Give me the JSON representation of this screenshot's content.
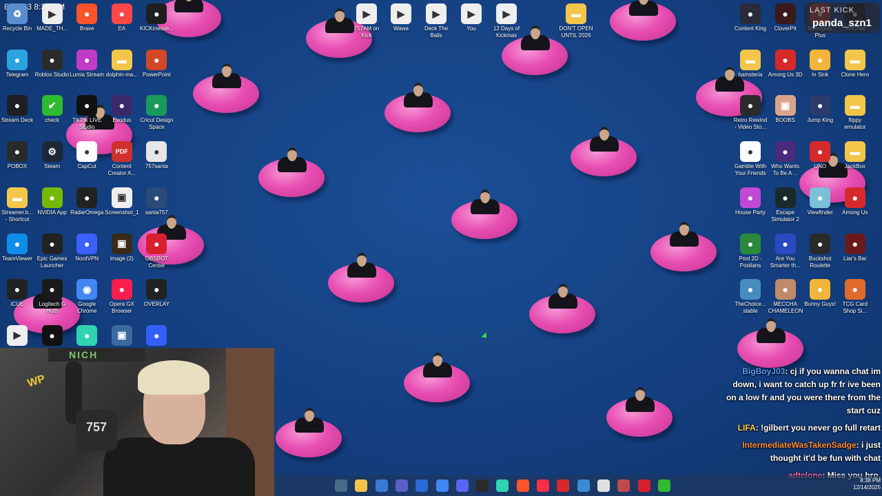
{
  "clock": {
    "text": "8:42:23 8:38 PM"
  },
  "kick_badge": {
    "line1": "LAST KICK",
    "line2": "panda_szn1"
  },
  "desktop_icons": {
    "left": [
      {
        "label": "Recycle Bin",
        "icon": "recycle-bin-icon",
        "color": "#5a8fcf"
      },
      {
        "label": "MADE_TH...",
        "icon": "video-file-icon",
        "color": "#eeeeee"
      },
      {
        "label": "Brave",
        "icon": "brave-icon",
        "color": "#fb542b"
      },
      {
        "label": "EA",
        "icon": "ea-icon",
        "color": "#ff4747"
      },
      {
        "label": "KICKmesse...",
        "icon": "kick-icon",
        "color": "#1f1f1f"
      },
      {
        "label": "Telegram",
        "icon": "telegram-icon",
        "color": "#2aa3df"
      },
      {
        "label": "Roblox Studio",
        "icon": "roblox-studio-icon",
        "color": "#2b2b2b"
      },
      {
        "label": "Lumia Stream",
        "icon": "lumia-stream-icon",
        "color": "#c03cc4"
      },
      {
        "label": "dolphin-ma...",
        "icon": "folder-icon",
        "color": "#f3c64a"
      },
      {
        "label": "PowerPoint",
        "icon": "powerpoint-icon",
        "color": "#d24726"
      },
      {
        "label": "Stream Deck",
        "icon": "stream-deck-icon",
        "color": "#1e1e24"
      },
      {
        "label": "check",
        "icon": "check-icon",
        "color": "#2fba2f"
      },
      {
        "label": "TikTok LIVE Studio",
        "icon": "tiktok-icon",
        "color": "#111111"
      },
      {
        "label": "Exodus",
        "icon": "exodus-icon",
        "color": "#3a2a6a"
      },
      {
        "label": "Cricut Design Space",
        "icon": "cricut-icon",
        "color": "#1a9a5a"
      },
      {
        "label": "POBOX",
        "icon": "pobox-icon",
        "color": "#2a2a2a"
      },
      {
        "label": "Steam",
        "icon": "steam-icon",
        "color": "#1b2838"
      },
      {
        "label": "CapCut",
        "icon": "capcut-icon",
        "color": "#ffffff"
      },
      {
        "label": "Content Creator A...",
        "icon": "pdf-icon",
        "color": "#d0302b"
      },
      {
        "label": "757santa",
        "icon": "757santa-icon",
        "color": "#e6e6e6"
      },
      {
        "label": "Streamer.b... - Shortcut",
        "icon": "folder-icon",
        "color": "#f3c64a"
      },
      {
        "label": "NVIDIA App",
        "icon": "nvidia-icon",
        "color": "#76b900"
      },
      {
        "label": "RadarOmega",
        "icon": "radaromega-icon",
        "color": "#222222"
      },
      {
        "label": "Screenshot_1",
        "icon": "image-file-icon",
        "color": "#eeeeee"
      },
      {
        "label": "santa757",
        "icon": "santa757-icon",
        "color": "#2a4a7a"
      },
      {
        "label": "TeamViewer",
        "icon": "teamviewer-icon",
        "color": "#0e8ee9"
      },
      {
        "label": "Epic Games Launcher",
        "icon": "epic-games-icon",
        "color": "#222222"
      },
      {
        "label": "NordVPN",
        "icon": "nordvpn-icon",
        "color": "#3e5fff"
      },
      {
        "label": "image (2)",
        "icon": "image-file-icon",
        "color": "#3a2a1a"
      },
      {
        "label": "OBSBOT Center",
        "icon": "obsbot-icon",
        "color": "#d81f2e"
      },
      {
        "label": "iCUE",
        "icon": "icue-icon",
        "color": "#222222"
      },
      {
        "label": "Logitech G HUB",
        "icon": "logitech-icon",
        "color": "#1a1a1a"
      },
      {
        "label": "Google Chrome",
        "icon": "chrome-icon",
        "color": "#4285f4"
      },
      {
        "label": "Opera GX Browser",
        "icon": "opera-gx-icon",
        "color": "#fa1e4e"
      },
      {
        "label": "OVERLAY",
        "icon": "overlay-icon",
        "color": "#222222"
      },
      {
        "label": "",
        "icon": "video-file-icon",
        "color": "#eeeeee"
      },
      {
        "label": "",
        "icon": "audio-wave-icon",
        "color": "#111111"
      },
      {
        "label": "",
        "icon": "chat-app-icon",
        "color": "#2fd3b0"
      },
      {
        "label": "",
        "icon": "image-file-icon",
        "color": "#3a6aa0"
      },
      {
        "label": "",
        "icon": "roblox-icon",
        "color": "#335fff"
      }
    ],
    "top": [
      {
        "label": "757AM on Kick",
        "icon": "video-file-icon",
        "color": "#eeeeee"
      },
      {
        "label": "Wawa",
        "icon": "video-file-icon",
        "color": "#eeeeee"
      },
      {
        "label": "Deck The Balls",
        "icon": "video-file-icon",
        "color": "#eeeeee"
      },
      {
        "label": "You",
        "icon": "video-file-icon",
        "color": "#eeeeee"
      },
      {
        "label": "12 Days of Kickmas",
        "icon": "video-file-icon",
        "color": "#eeeeee"
      },
      {
        "label": "DON'T OPEN UNTIL 2026",
        "icon": "folder-icon",
        "color": "#f3c64a"
      }
    ],
    "right": [
      {
        "label": "Content King",
        "icon": "content-king-icon",
        "color": "#2a2a3a"
      },
      {
        "label": "CloverPit",
        "icon": "cloverpit-icon",
        "color": "#3a1a1a"
      },
      {
        "label": "Monopoly Plus",
        "icon": "monopoly-icon",
        "color": "#c0392b"
      },
      {
        "label": "VRChat",
        "icon": "vrchat-icon",
        "color": "#111111"
      },
      {
        "label": "hamsteria",
        "icon": "folder-icon",
        "color": "#f3c64a"
      },
      {
        "label": "Among Us 3D",
        "icon": "among-us-3d-icon",
        "color": "#d62a2a"
      },
      {
        "label": "In Sink",
        "icon": "in-sink-icon",
        "color": "#f2b43a"
      },
      {
        "label": "Clone Hero",
        "icon": "folder-icon",
        "color": "#f3c64a"
      },
      {
        "label": "Retro Rewind - Video Sto...",
        "icon": "retro-rewind-icon",
        "color": "#2a2a2a"
      },
      {
        "label": "BOOBS",
        "icon": "image-file-icon",
        "color": "#d9a58a"
      },
      {
        "label": "Jump King",
        "icon": "jump-king-icon",
        "color": "#2a3a6a"
      },
      {
        "label": "flippy emulator",
        "icon": "folder-icon",
        "color": "#f3c64a"
      },
      {
        "label": "Gamble With Your Friends",
        "icon": "gamble-icon",
        "color": "#ffffff"
      },
      {
        "label": "Who Wants To Be A ...",
        "icon": "millionaire-icon",
        "color": "#4a2a7a"
      },
      {
        "label": "UNO",
        "icon": "uno-icon",
        "color": "#d62a2a"
      },
      {
        "label": "JackBox",
        "icon": "folder-icon",
        "color": "#f3c64a"
      },
      {
        "label": "House Party",
        "icon": "house-party-icon",
        "color": "#c04ad6"
      },
      {
        "label": "Escape Simulator 2",
        "icon": "escape-sim-icon",
        "color": "#1a2a2a"
      },
      {
        "label": "Viewfinder",
        "icon": "viewfinder-icon",
        "color": "#7ac0d6"
      },
      {
        "label": "Among Us",
        "icon": "among-us-icon",
        "color": "#d62a2a"
      },
      {
        "label": "Pool 2D - Poolians",
        "icon": "pool-icon",
        "color": "#2a8a3a"
      },
      {
        "label": "Are You Smarter th...",
        "icon": "smarter-icon",
        "color": "#2a4ac0"
      },
      {
        "label": "Buckshot Roulette",
        "icon": "buckshot-icon",
        "color": "#2a2a2a"
      },
      {
        "label": "Liar's Bar",
        "icon": "liars-bar-icon",
        "color": "#6a1a1a"
      },
      {
        "label": "TheChoice... stable",
        "icon": "godot-icon",
        "color": "#478cbf"
      },
      {
        "label": "MECCHA CHAMELEON",
        "icon": "meccha-icon",
        "color": "#c08a6a"
      },
      {
        "label": "Bunny Guys!",
        "icon": "bunny-guys-icon",
        "color": "#f2b43a"
      },
      {
        "label": "TCG Card Shop Si...",
        "icon": "tcg-icon",
        "color": "#e06a2a"
      }
    ]
  },
  "webcam": {
    "sign": "NICH",
    "mic_logo": "757",
    "mic_tag": "WP"
  },
  "chat": [
    {
      "user": "BigBoyJ03",
      "text": ": cj if you wanna chat im down, i want to catch up fr fr ive been on a low fr and you were there from the start cuz"
    },
    {
      "user": "LIFA",
      "text": ": !gilbert you never go full retart"
    },
    {
      "user": "IntermediateWasTakenSadge",
      "text": ": i just thought it'd be fun with chat"
    },
    {
      "user": "adtclone",
      "text": ": Miss you bro."
    }
  ],
  "taskbar": {
    "time": "8:38 PM",
    "date": "12/14/2025",
    "apps": [
      "file-explorer-icon",
      "folder-icon",
      "copilot-icon",
      "teams-icon",
      "store-icon",
      "chrome-icon",
      "discord-icon",
      "obs-icon",
      "chat-app-icon",
      "brave-icon",
      "music-icon",
      "red-app-icon",
      "help-icon",
      "folder-up-icon",
      "radar-icon",
      "obsbot-icon",
      "xbox-icon"
    ]
  },
  "colors": {
    "desktop_bg": "#143f80",
    "ball": "#e84fb3",
    "chat_text": "#ffffff"
  }
}
